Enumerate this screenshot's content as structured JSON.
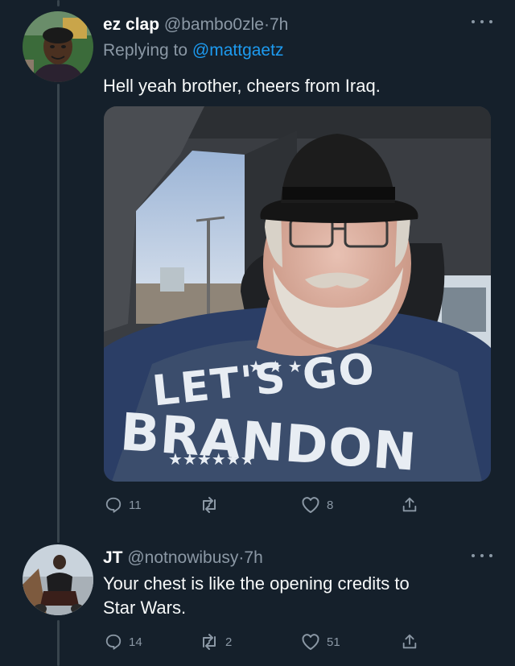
{
  "tweets": [
    {
      "display_name": "ez clap",
      "handle": "@bambo0zle",
      "separator": "·",
      "time": "7h",
      "replying_prefix": "Replying to ",
      "replying_to": "@mattgaetz",
      "text": "Hell yeah brother, cheers from Iraq.",
      "media": {
        "shirt_text_line1": "LET'S GO",
        "shirt_text_line2": "BRANDON",
        "icons": [
          "person-photo"
        ]
      },
      "actions": {
        "reply_count": "11",
        "retweet_count": "",
        "like_count": "8"
      }
    },
    {
      "display_name": "JT",
      "handle": "@notnowibusy",
      "separator": "·",
      "time": "7h",
      "text_line1": "Your chest is like the opening credits to",
      "text_line2": "Star Wars.",
      "actions": {
        "reply_count": "14",
        "retweet_count": "2",
        "like_count": "51"
      }
    }
  ],
  "icons": [
    "reply-icon",
    "retweet-icon",
    "like-icon",
    "share-icon",
    "more-icon"
  ],
  "colors": {
    "background": "#15202b",
    "secondary_text": "#8b98a5",
    "link": "#1d9bf0",
    "thread_line": "#38444d"
  }
}
